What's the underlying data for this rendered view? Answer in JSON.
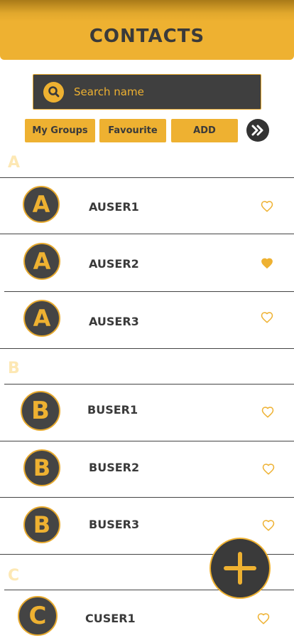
{
  "header": {
    "title": "CONTACTS"
  },
  "search": {
    "placeholder": "Search name",
    "icon": "search-icon"
  },
  "filters": {
    "my_groups_label": "My Groups",
    "favourite_label": "Favourite",
    "add_label": "ADD",
    "more_icon": "double-chevron-right-icon"
  },
  "sections": [
    {
      "letter": "A",
      "contacts": [
        {
          "initial": "A",
          "name": "AUSER1",
          "favourite": false
        },
        {
          "initial": "A",
          "name": "AUSER2",
          "favourite": true
        },
        {
          "initial": "A",
          "name": "AUSER3",
          "favourite": false
        }
      ]
    },
    {
      "letter": "B",
      "contacts": [
        {
          "initial": "B",
          "name": "BUSER1",
          "favourite": false
        },
        {
          "initial": "B",
          "name": "BUSER2",
          "favourite": false
        },
        {
          "initial": "B",
          "name": "BUSER3",
          "favourite": false
        }
      ]
    },
    {
      "letter": "C",
      "contacts": [
        {
          "initial": "C",
          "name": "CUSER1",
          "favourite": false
        }
      ]
    }
  ],
  "fab": {
    "icon": "plus-icon"
  },
  "colors": {
    "accent": "#eeb131",
    "dark": "#3a3a3a",
    "section_letter": "#fde8b4"
  }
}
